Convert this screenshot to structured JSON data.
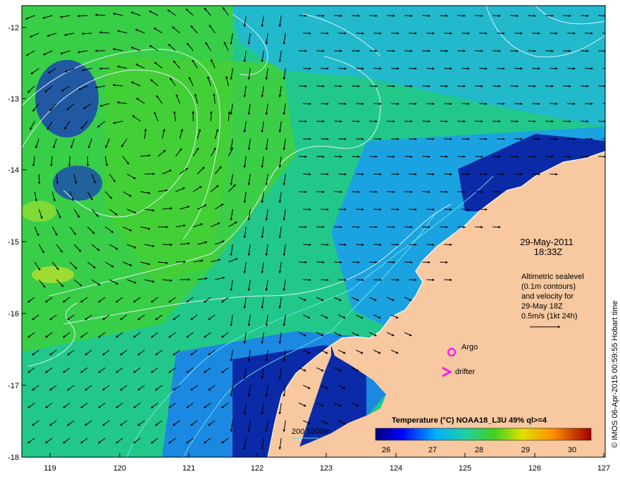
{
  "map": {
    "date": "29-May-2011",
    "time": "18:33Z",
    "annotation_lines": [
      "Altimetric sealevel",
      "(0.1m contours)",
      "and velocity for",
      "29-May 18Z",
      "0.5m/s (1kt 24h)"
    ],
    "legend_argo": "Argo",
    "legend_drifter": "drifter",
    "depth_scale": "200  1000m",
    "colorbar_title": "Temperature (°C) NOAA18_L3U 49% ql>=4",
    "colorbar_ticks": [
      "26",
      "27",
      "28",
      "29",
      "30"
    ],
    "side_credit": "© IMOS 06-Apr-2015 00:59:55 Hobart time",
    "lat_labels": [
      "-12",
      "-13",
      "-14",
      "-15",
      "-16",
      "-17",
      "-18"
    ],
    "lon_labels": [
      "119",
      "120",
      "121",
      "122",
      "123",
      "124",
      "125",
      "126",
      "127"
    ],
    "colors": {
      "land": "#f8c8a0",
      "sst_cold": "#000090",
      "sst_cool": "#1e8cf0",
      "sst_mid": "#20c878",
      "sst_warm": "#40d020",
      "argo": "#ff00ff",
      "drifter": "#ff00ff",
      "contour": "#e8f0ff",
      "depth_200": "#60e0e0"
    }
  }
}
